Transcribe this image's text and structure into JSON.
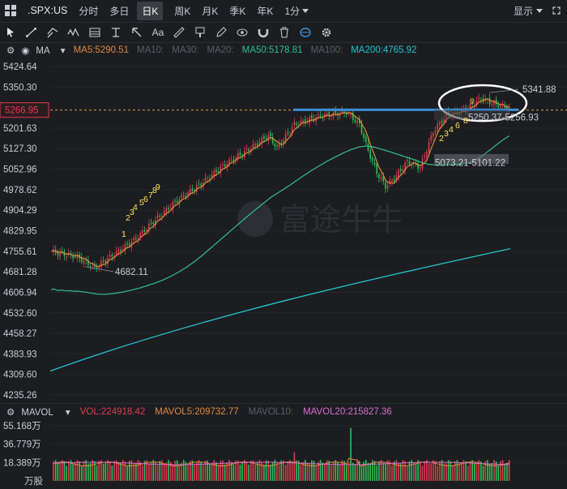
{
  "header": {
    "ticker": ".SPX:US",
    "timeframes": [
      "分时",
      "多日"
    ],
    "active_timeframe": "日K",
    "more_timeframes": [
      "周K",
      "月K",
      "季K",
      "年K"
    ],
    "interval": "1分",
    "display_label": "显示"
  },
  "ma_bar": {
    "type_label": "MA",
    "ma5": "MA5:5290.51",
    "ma10": "MA10:",
    "ma30": "MA30:",
    "ma20": "MA20:",
    "ma50": "MA50:5178.81",
    "ma100": "MA100:",
    "ma200": "MA200:4765.92",
    "colors": {
      "ma5": "#e08a3c",
      "ma10": "#5a5a60",
      "ma50": "#2fc08a",
      "ma200": "#23c4cc",
      "inactive": "#5a5e66"
    }
  },
  "price_axis": {
    "ticks": [
      "5424.64",
      "5350.30",
      "5201.63",
      "5127.30",
      "5052.96",
      "4978.62",
      "4904.29",
      "4829.95",
      "4755.61",
      "4681.28",
      "4606.94",
      "4532.60",
      "4458.27",
      "4383.93",
      "4309.60",
      "4235.26"
    ],
    "current_price": "5266.95",
    "current_price_color": "#e23a4e"
  },
  "annotations": {
    "high_label": "5341.88",
    "low_label": "4682.11",
    "range_upper": "5250.37-5256.93",
    "range_lower": "5073.21-5101.22",
    "watermark": "富途牛牛",
    "td_counts_first": [
      "1",
      "2",
      "3",
      "4",
      "5",
      "6",
      "7",
      "8",
      "9"
    ],
    "td_counts_second": [
      "2",
      "3",
      "4",
      "6",
      "8",
      "9"
    ]
  },
  "volume": {
    "indicator": "MAVOL",
    "vol": "VOL:224918.42",
    "mavol5": "MAVOL5:209732.77",
    "mavol10": "MAVOL10:",
    "mavol20": "MAVOL20:215827.36",
    "axis": [
      "55.168万",
      "36.779万",
      "18.389万"
    ],
    "unit": "万股",
    "colors": {
      "vol": "#e23a4e",
      "mavol5": "#e08a3c",
      "mavol10": "#5a5e66",
      "mavol20": "#d46fd0"
    }
  },
  "colors": {
    "up": "#e23a4e",
    "down": "#2fc05a",
    "support_line": "#3b8fd9",
    "circle": "#ffffff",
    "price_text": "#c9ccd3"
  }
}
